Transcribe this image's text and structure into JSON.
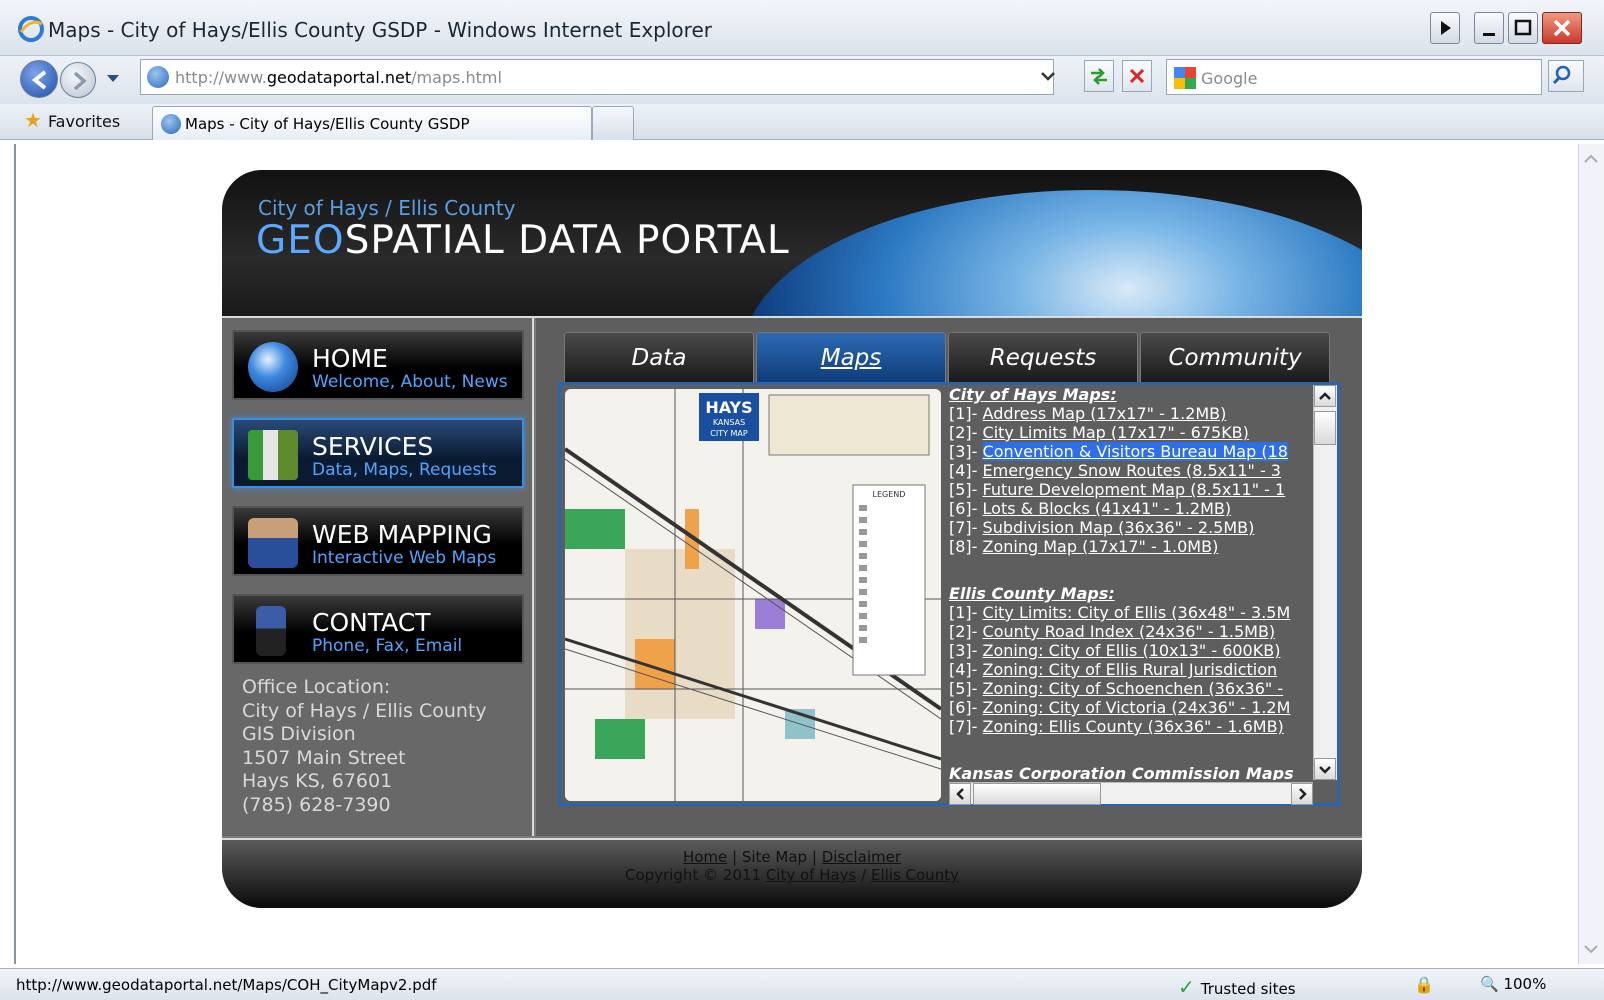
{
  "window": {
    "title": "Maps - City of Hays/Ellis County GSDP - Windows Internet Explorer"
  },
  "address_bar": {
    "url_prefix": "http://www.",
    "url_domain": "geodataportal.net",
    "url_path": "/maps.html"
  },
  "search": {
    "placeholder": "Google"
  },
  "favorites_label": "Favorites",
  "tab": {
    "label": "Maps - City of Hays/Ellis County GSDP"
  },
  "status": {
    "text": "http://www.geodataportal.net/Maps/COH_CityMapv2.pdf",
    "zone": "Trusted sites",
    "zoom": "100%"
  },
  "banner": {
    "subtitle": "City of Hays / Ellis County",
    "title_accent": "GEO",
    "title_rest": "SPATIAL DATA PORTAL"
  },
  "nav": [
    {
      "title": "HOME",
      "subtitle": "Welcome, About, News"
    },
    {
      "title": "SERVICES",
      "subtitle": "Data, Maps, Requests"
    },
    {
      "title": "WEB MAPPING",
      "subtitle": "Interactive Web Maps"
    },
    {
      "title": "CONTACT",
      "subtitle": "Phone, Fax, Email"
    }
  ],
  "office": {
    "lines": [
      "Office Location:",
      "City of Hays / Ellis County",
      "GIS Division",
      "1507 Main Street",
      "Hays KS, 67601",
      "(785) 628-7390"
    ]
  },
  "portal_tabs": [
    "Data",
    "Maps",
    "Requests",
    "Community"
  ],
  "map_image": {
    "title": "HAYS",
    "state": "KANSAS",
    "caption": "CITY MAP",
    "legend": "LEGEND"
  },
  "maps_list": {
    "city_heading": "City of Hays Maps:",
    "city_items": [
      {
        "num": "[1]-",
        "label": "Address Map (17x17\" - 1.2MB)"
      },
      {
        "num": "[2]-",
        "label": "City Limits Map (17x17\" - 675KB)"
      },
      {
        "num": "[3]-",
        "label": "Convention & Visitors Bureau Map (18"
      },
      {
        "num": "[4]-",
        "label": "Emergency Snow Routes (8.5x11\" - 3"
      },
      {
        "num": "[5]-",
        "label": "Future Development Map (8.5x11\" - 1"
      },
      {
        "num": "[6]-",
        "label": "Lots & Blocks (41x41\" - 1.2MB)"
      },
      {
        "num": "[7]-",
        "label": "Subdivision Map (36x36\" - 2.5MB)"
      },
      {
        "num": "[8]-",
        "label": "Zoning Map (17x17\" - 1.0MB)"
      }
    ],
    "county_heading": "Ellis County Maps:",
    "county_items": [
      {
        "num": "[1]-",
        "label": "City Limits: City of Ellis (36x48\" - 3.5M"
      },
      {
        "num": "[2]-",
        "label": "County Road Index (24x36\" - 1.5MB)"
      },
      {
        "num": "[3]-",
        "label": "Zoning: City of Ellis (10x13\" - 600KB)"
      },
      {
        "num": "[4]-",
        "label": "Zoning: City of Ellis Rural Jurisdiction"
      },
      {
        "num": "[5]-",
        "label": "Zoning: City of Schoenchen (36x36\" -"
      },
      {
        "num": "[6]-",
        "label": "Zoning: City of Victoria (24x36\" - 1.2M"
      },
      {
        "num": "[7]-",
        "label": "Zoning: Ellis County (36x36\" - 1.6MB)"
      }
    ],
    "kcc_heading": "Kansas Corporation Commission Maps"
  },
  "footer": {
    "home": "Home",
    "sep1": " | ",
    "sitemap": "Site Map",
    "sep2": " | ",
    "disclaimer": "Disclaimer",
    "copyright": "Copyright © 2011 ",
    "city": "City of Hays",
    "slash": " / ",
    "county": "Ellis County"
  },
  "colors": {
    "accent": "#2e6ee6",
    "nav_subtitle": "#4ea5ff",
    "active_tab": "#2d69b3"
  }
}
